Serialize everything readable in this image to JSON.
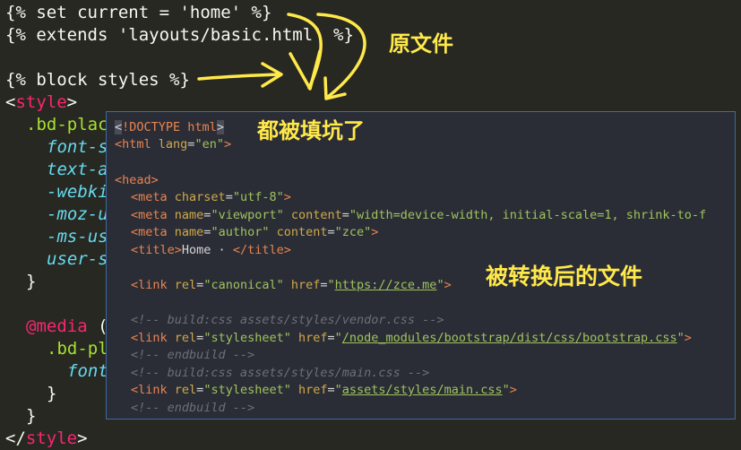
{
  "editor": {
    "line1": "{% set current = 'home' %}",
    "line2": "{% extends 'layouts/basic.html' %}",
    "line3": "{% block styles %}",
    "style_open_lt": "<",
    "style_open_tag": "style",
    "style_open_gt": ">",
    "selector_bd": ".bd-plac",
    "prop1": "font-s",
    "prop2": "text-a",
    "prop3": "-webki",
    "prop4": "-moz-u",
    "prop5": "-ms-us",
    "prop6": "user-s",
    "brace1": "}",
    "media_kw": "@media",
    "media_rest": " (",
    "selector_bd2": ".bd-pl",
    "prop7": "font",
    "brace2": "}",
    "brace3": "}",
    "style_close_lt": "</",
    "style_close_tag": "style",
    "style_close_gt": ">"
  },
  "popup": {
    "doctype_open": "<",
    "doctype_text": "!DOCTYPE html",
    "doctype_close": ">",
    "html_tag": "<html ",
    "html_attr": "lang",
    "html_eq": "=",
    "html_val": "\"en\"",
    "html_end": ">",
    "head_tag": "<head>",
    "meta1_tag": "<meta ",
    "meta1_attr": "charset",
    "meta1_val": "\"utf-8\"",
    "meta1_end": ">",
    "meta2_tag": "<meta ",
    "meta2_attr1": "name",
    "meta2_val1": "\"viewport\"",
    "meta2_attr2": " content",
    "meta2_val2": "\"width=device-width, initial-scale=1, shrink-to-f",
    "meta3_tag": "<meta ",
    "meta3_attr1": "name",
    "meta3_val1": "\"author\"",
    "meta3_attr2": " content",
    "meta3_val2": "\"zce\"",
    "meta3_end": ">",
    "title_open": "<title>",
    "title_text": "Home · ",
    "title_close": "</title>",
    "link1_tag": "<link ",
    "link1_attr1": "rel",
    "link1_val1": "\"canonical\"",
    "link1_attr2": " href",
    "link1_q1": "\"",
    "link1_url": "https://zce.me",
    "link1_q2": "\"",
    "link1_end": ">",
    "comment1": "<!-- build:css assets/styles/vendor.css -->",
    "link2_tag": "<link ",
    "link2_attr1": "rel",
    "link2_val1": "\"stylesheet\"",
    "link2_attr2": " href",
    "link2_q1": "\"",
    "link2_url": "/node_modules/bootstrap/dist/css/bootstrap.css",
    "link2_q2": "\"",
    "link2_end": ">",
    "comment2": "<!-- endbuild -->",
    "comment3": "<!-- build:css assets/styles/main.css -->",
    "link3_tag": "<link ",
    "link3_attr1": "rel",
    "link3_val1": "\"stylesheet\"",
    "link3_attr2": " href",
    "link3_q1": "\"",
    "link3_url": "assets/styles/main.css",
    "link3_q2": "\"",
    "link3_end": ">",
    "comment4": "<!-- endbuild -->"
  },
  "annotations": {
    "original_file": "原文件",
    "filled": "都被填坑了",
    "converted_file": "被转换后的文件",
    "color": "#ffe94a"
  }
}
